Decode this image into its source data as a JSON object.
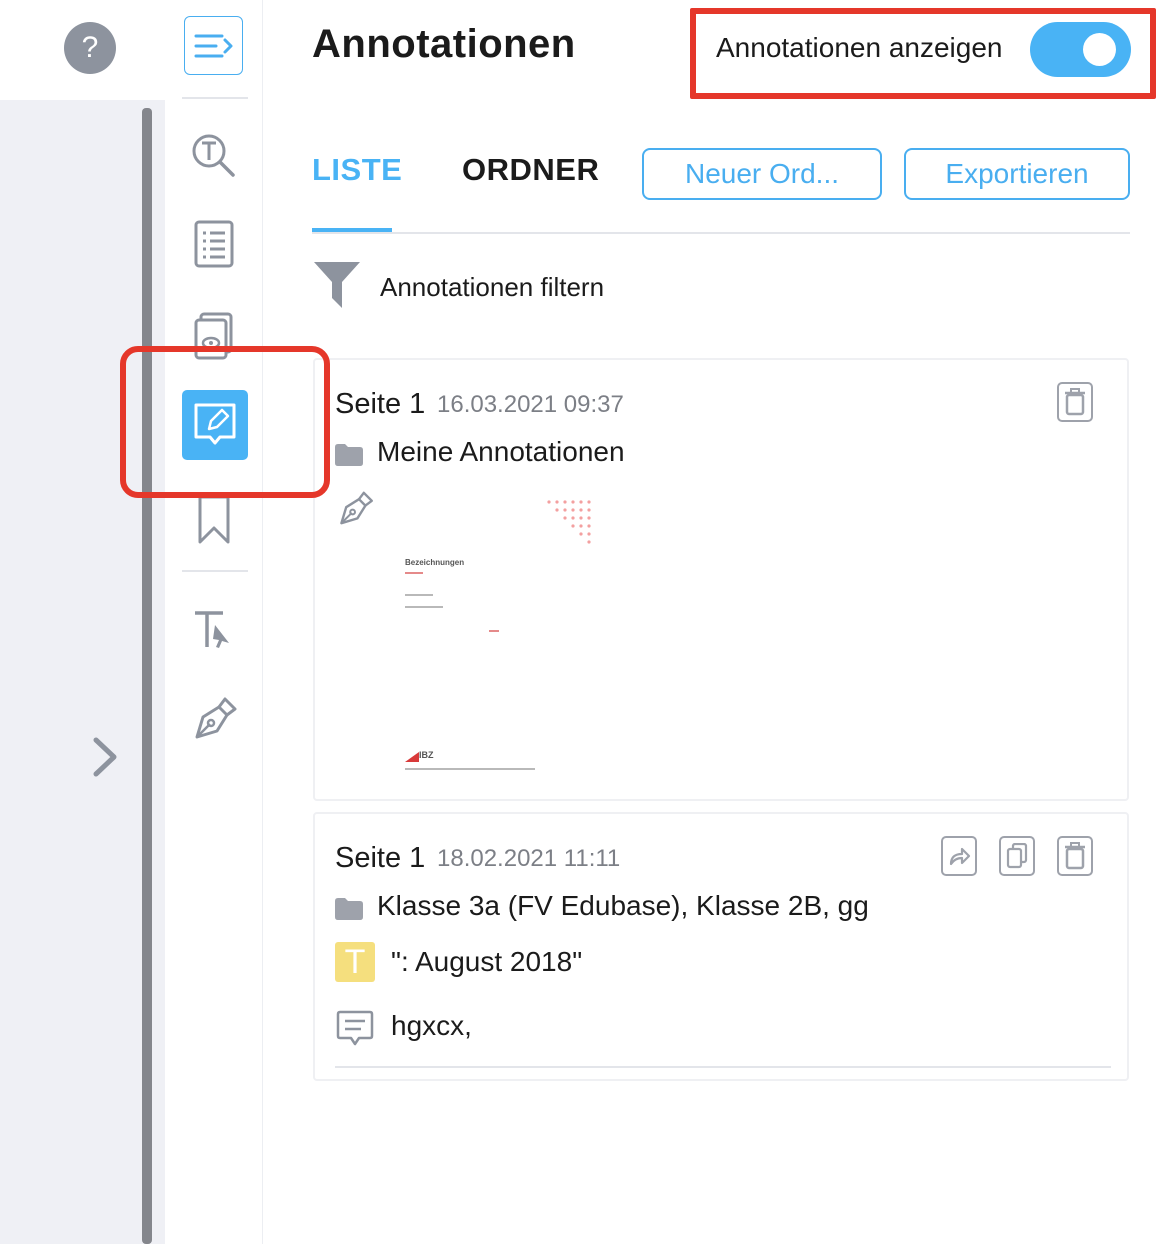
{
  "help": {
    "glyph": "?"
  },
  "header": {
    "title": "Annotationen",
    "toggle_label": "Annotationen anzeigen",
    "toggle_on": true
  },
  "tabs": [
    {
      "label": "LISTE",
      "active": true
    },
    {
      "label": "ORDNER",
      "active": false
    }
  ],
  "buttons": {
    "new_folder": "Neuer Ord...",
    "export": "Exportieren"
  },
  "filter": {
    "label": "Annotationen filtern"
  },
  "annotations": [
    {
      "page": "Seite 1",
      "date": "16.03.2021 09:37",
      "folder": "Meine Annotationen",
      "type_icon": "pen-icon",
      "preview": {
        "heading": "Bezeichnungen",
        "logo": "IBZ"
      },
      "actions": [
        "delete-icon"
      ]
    },
    {
      "page": "Seite 1",
      "date": "18.02.2021 11:11",
      "folder": "Klasse 3a (FV Edubase), Klasse 2B, gg",
      "highlight_glyph": "T",
      "quote": "\": August 2018\"",
      "comment": "hgxcx,",
      "actions": [
        "share-icon",
        "copy-icon",
        "delete-icon"
      ]
    }
  ],
  "colors": {
    "accent": "#49b3f5",
    "highlight_box": "#e5372a",
    "text_mark": "#f5df7e",
    "muted": "#7c7f86"
  }
}
